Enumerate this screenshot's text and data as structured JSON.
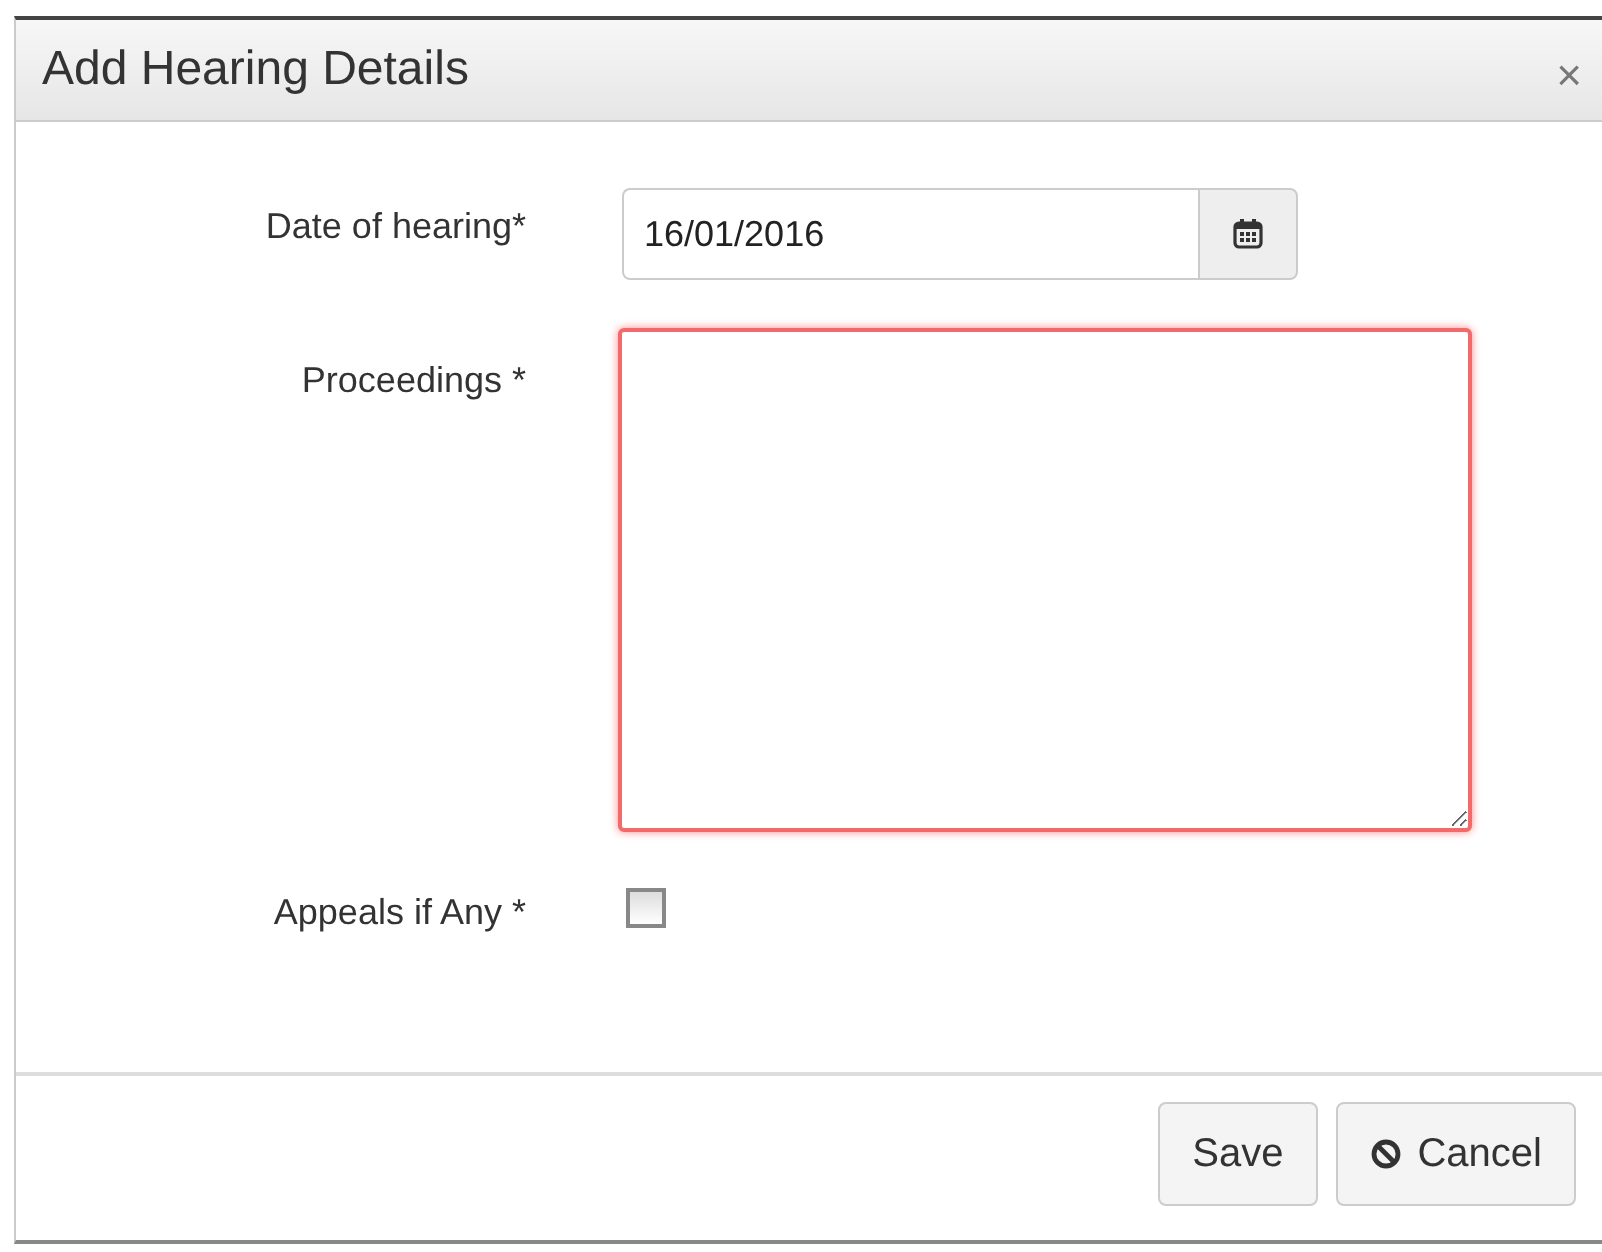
{
  "dialog": {
    "title": "Add Hearing Details",
    "close": "×"
  },
  "fields": [
    {
      "kind": "date",
      "label": "Date of hearing*",
      "value": "16/01/2016"
    },
    {
      "kind": "textarea",
      "label": "Proceedings *",
      "invalid": true
    },
    {
      "kind": "checkbox",
      "label": "Appeals if Any *",
      "checked": false
    }
  ],
  "buttons": [
    {
      "kind": "plain",
      "label": "Save"
    },
    {
      "kind": "cancel",
      "label": "Cancel"
    }
  ]
}
